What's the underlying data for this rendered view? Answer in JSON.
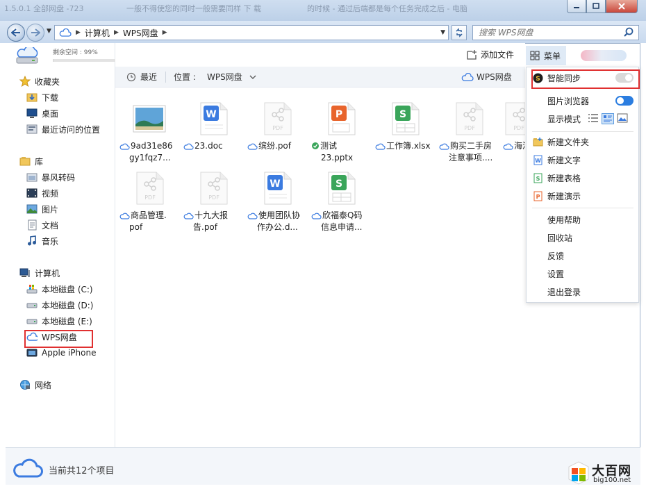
{
  "window": {
    "ghost_texts": [
      "1.5.0.1 全部网盘 -723",
      "一般不得使您的同时一般需要同样 下 载",
      "的时候 - 通过后端都是每个任务完成之后 - 电脑"
    ],
    "controls": [
      "minimize",
      "maximize",
      "close"
    ]
  },
  "address_bar": {
    "path": [
      "计算机",
      "WPS网盘"
    ],
    "search_placeholder": "搜索 WPS网盘"
  },
  "quota": {
    "label": "剩余空间 : 99%",
    "used_fraction": 0.01
  },
  "sidebar": {
    "favorites": {
      "label": "收藏夹",
      "items": [
        {
          "label": "下载"
        },
        {
          "label": "桌面"
        },
        {
          "label": "最近访问的位置"
        }
      ]
    },
    "libraries": {
      "label": "库",
      "items": [
        {
          "label": "暴风转码"
        },
        {
          "label": "视频"
        },
        {
          "label": "图片"
        },
        {
          "label": "文档"
        },
        {
          "label": "音乐"
        }
      ]
    },
    "computer": {
      "label": "计算机",
      "items": [
        {
          "label": "本地磁盘 (C:)"
        },
        {
          "label": "本地磁盘 (D:)"
        },
        {
          "label": "本地磁盘 (E:)"
        },
        {
          "label": "WPS网盘",
          "highlighted": true
        },
        {
          "label": "Apple iPhone"
        }
      ]
    },
    "network": {
      "label": "网络"
    }
  },
  "toolbar": {
    "add_file": "添加文件",
    "menu": "菜单"
  },
  "crumbbar": {
    "recent": "最近",
    "location_label": "位置 :",
    "location_value": "WPS网盘",
    "right_label": "WPS网盘"
  },
  "files": [
    {
      "name_lines": [
        "9ad31e86",
        "gy1fqz7..."
      ],
      "type": "image",
      "sync": "cloud"
    },
    {
      "name_lines": [
        "23.doc"
      ],
      "type": "word",
      "sync": "cloud"
    },
    {
      "name_lines": [
        "缤纷.pof"
      ],
      "type": "pdf",
      "sync": "cloud"
    },
    {
      "name_lines": [
        "测试",
        "23.pptx"
      ],
      "type": "ppt",
      "sync": "synced"
    },
    {
      "name_lines": [
        "工作簿.xlsx"
      ],
      "type": "excel",
      "sync": "cloud"
    },
    {
      "name_lines": [
        "购买二手房",
        "注意事项...."
      ],
      "type": "pdf",
      "sync": "cloud"
    },
    {
      "name_lines": [
        "海洋"
      ],
      "type": "pdf",
      "sync": "cloud"
    },
    {
      "name_lines": [
        "商品管理.",
        "pof"
      ],
      "type": "pdf",
      "sync": "cloud"
    },
    {
      "name_lines": [
        "十九大报",
        "告.pof"
      ],
      "type": "pdf",
      "sync": "cloud"
    },
    {
      "name_lines": [
        "使用团队协",
        "作办公.d..."
      ],
      "type": "word",
      "sync": "cloud"
    },
    {
      "name_lines": [
        "欣福泰Q码",
        "信息申请..."
      ],
      "type": "excel",
      "sync": "cloud"
    }
  ],
  "menu": {
    "smart_sync": {
      "label": "智能同步",
      "on": false
    },
    "image_browser": {
      "label": "图片浏览器",
      "on": true
    },
    "display_mode": {
      "label": "显示模式"
    },
    "new_items": [
      {
        "label": "新建文件夹",
        "icon": "folder-icon"
      },
      {
        "label": "新建文字",
        "icon": "word-icon"
      },
      {
        "label": "新建表格",
        "icon": "excel-icon"
      },
      {
        "label": "新建演示",
        "icon": "ppt-icon"
      }
    ],
    "misc_items": [
      {
        "label": "使用帮助"
      },
      {
        "label": "回收站"
      },
      {
        "label": "反馈"
      },
      {
        "label": "设置"
      },
      {
        "label": "退出登录"
      }
    ]
  },
  "status": {
    "text": "当前共12个项目"
  },
  "watermark": {
    "title": "大百网",
    "url": "big100.net"
  },
  "colors": {
    "accent_blue": "#2b7de0",
    "highlight_red": "#e03030",
    "word": "#3b7be0",
    "ppt": "#e8642c",
    "excel": "#3aa55a",
    "pdf_gray": "#d7d7d7"
  }
}
